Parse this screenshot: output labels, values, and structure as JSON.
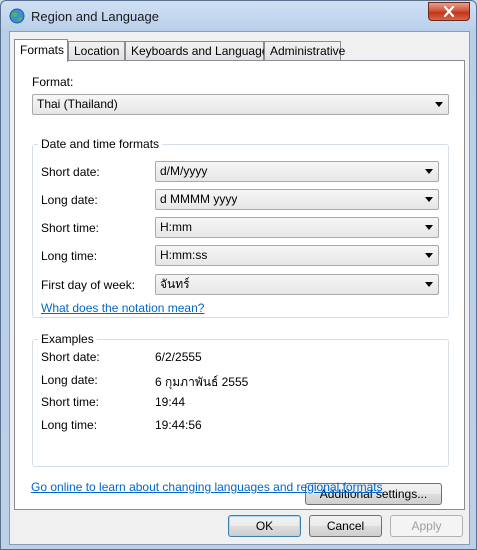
{
  "window": {
    "title": "Region and Language",
    "icon": "globe-icon"
  },
  "tabs": [
    {
      "label": "Formats",
      "active": true
    },
    {
      "label": "Location",
      "active": false
    },
    {
      "label": "Keyboards and Languages",
      "active": false
    },
    {
      "label": "Administrative",
      "active": false
    }
  ],
  "format": {
    "label": "Format:",
    "value": "Thai (Thailand)"
  },
  "datetime": {
    "title": "Date and time formats",
    "short_date": {
      "label": "Short date:",
      "value": "d/M/yyyy"
    },
    "long_date": {
      "label": "Long date:",
      "value": "d MMMM yyyy"
    },
    "short_time": {
      "label": "Short time:",
      "value": "H:mm"
    },
    "long_time": {
      "label": "Long time:",
      "value": "H:mm:ss"
    },
    "first_day": {
      "label": "First day of week:",
      "value": "จันทร์"
    },
    "notation_link": "What does the notation mean?"
  },
  "examples": {
    "title": "Examples",
    "short_date": {
      "label": "Short date:",
      "value": "6/2/2555"
    },
    "long_date": {
      "label": "Long date:",
      "value": "6 กุมภาพันธ์ 2555"
    },
    "short_time": {
      "label": "Short time:",
      "value": "19:44"
    },
    "long_time": {
      "label": "Long time:",
      "value": "19:44:56"
    }
  },
  "additional_settings": "Additional settings...",
  "online_link": "Go online to learn about changing languages and regional formats",
  "buttons": {
    "ok": "OK",
    "cancel": "Cancel",
    "apply": "Apply"
  },
  "colors": {
    "link": "#0066cc",
    "annotation_arrow": "#e8221b",
    "close_button": "#c0361b"
  }
}
